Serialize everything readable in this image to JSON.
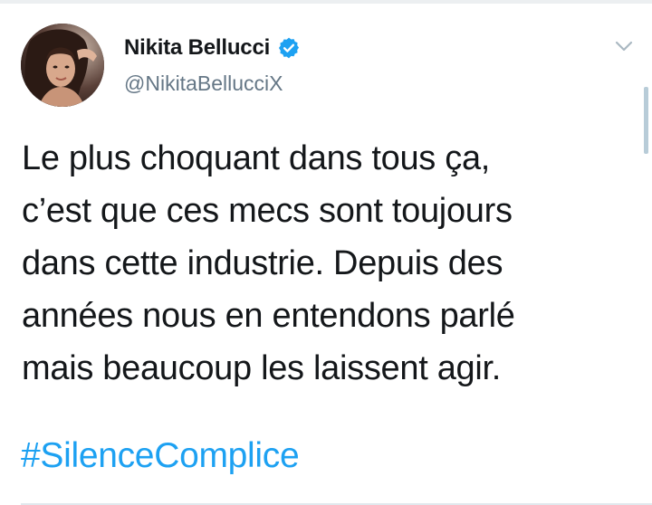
{
  "author": {
    "display_name": "Nikita Bellucci",
    "handle": "@NikitaBellucciX",
    "verified": true,
    "avatar_icon": "profile-photo"
  },
  "tweet": {
    "lines": [
      "Le plus choquant dans tous ça,",
      "c’est que ces mecs sont toujours",
      "dans cette industrie. Depuis des",
      "années nous en entendons parlé",
      "mais beaucoup les laissent agir."
    ],
    "hashtag": "#SilenceComplice"
  },
  "icons": {
    "verified": "verified-badge-icon",
    "menu": "chevron-down-icon"
  },
  "colors": {
    "link": "#1da1f2",
    "verified": "#1da1f2",
    "text": "#14171a",
    "secondary_text": "#657786"
  }
}
